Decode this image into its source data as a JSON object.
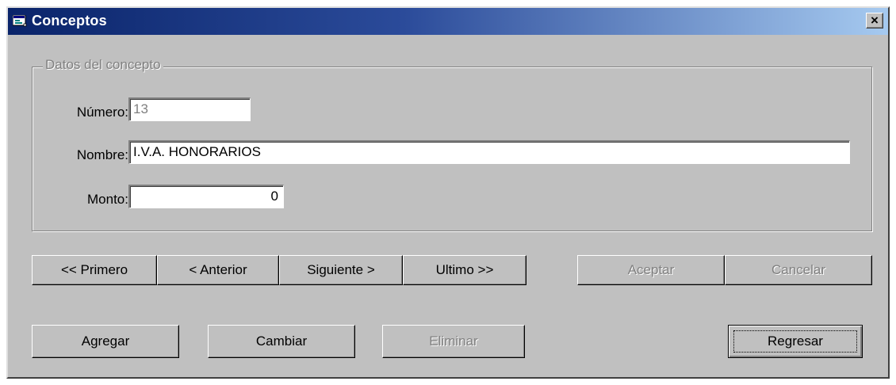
{
  "window": {
    "title": "Conceptos",
    "close_label": "×"
  },
  "group": {
    "legend": "Datos del concepto"
  },
  "fields": {
    "numero": {
      "label": "Número:",
      "value": "13"
    },
    "nombre": {
      "label": "Nombre:",
      "value": "I.V.A. HONORARIOS"
    },
    "monto": {
      "label": "Monto:",
      "value": "0"
    }
  },
  "nav_buttons": {
    "primero": "<< Primero",
    "anterior": "< Anterior",
    "siguiente": "Siguiente >",
    "ultimo": "Ultimo >>"
  },
  "action_buttons": {
    "aceptar": "Aceptar",
    "cancelar": "Cancelar",
    "agregar": "Agregar",
    "cambiar": "Cambiar",
    "eliminar": "Eliminar",
    "regresar": "Regresar"
  },
  "icons": {
    "app": "form-window-icon",
    "close": "close-icon"
  }
}
